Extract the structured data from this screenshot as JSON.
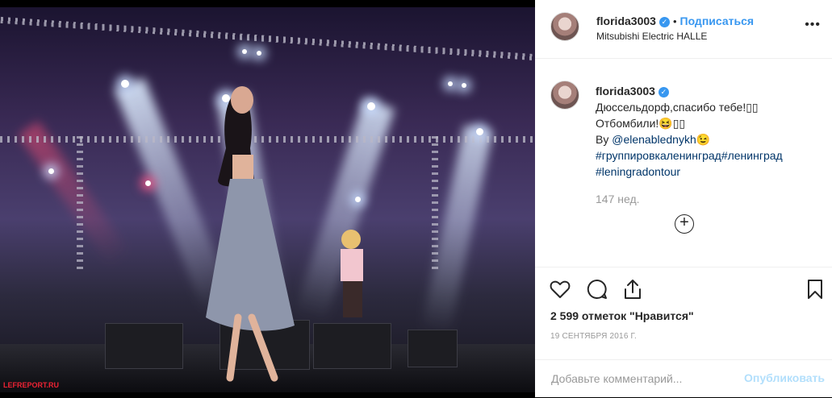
{
  "post": {
    "username": "florida3003",
    "verified_badge": "✓",
    "follow_label": "Подписаться",
    "location": "Mitsubishi Electric HALLE",
    "more_icon": "more-horizontal-icon",
    "caption": {
      "username": "florida3003",
      "lines": [
        "Дюссельдорф,спасибо тебе!🏻🏻",
        "Отбомбили!😆🏻🏻",
        "By @elenabledny kh😉"
      ],
      "text_line1": "Дюссельдорф,спасибо тебе!▯▯",
      "text_line2": "Отбомбили!😆▯▯",
      "by_prefix": "By ",
      "mention": "@elenablednykh",
      "mention_emoji": "😉",
      "hashtags_line1": "#группировкаленинград#ленинград",
      "hashtags_line2": "#leningradontour"
    },
    "age": "147 нед.",
    "likes_label": "2 599 отметок \"Нравится\"",
    "date": "19 СЕНТЯБРЯ 2016 Г.",
    "comment_placeholder": "Добавьте комментарий...",
    "publish_label": "Опубликовать",
    "photo_watermark": "LEFREPORT.RU"
  },
  "icons": [
    "heart-icon",
    "comment-icon",
    "share-icon",
    "bookmark-icon",
    "load-more-icon"
  ],
  "colors": {
    "accent": "#3897f0",
    "publish_disabled": "#b2dffc",
    "text": "#262626",
    "muted": "#999999"
  }
}
